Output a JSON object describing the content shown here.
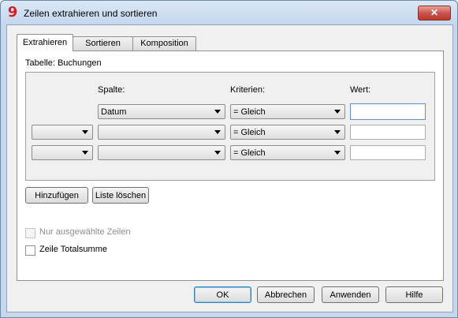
{
  "window": {
    "title": "Zeilen extrahieren und sortieren",
    "app_icon_glyph": "9",
    "close_glyph": "✕"
  },
  "tabs": [
    {
      "label": "Extrahieren",
      "active": true
    },
    {
      "label": "Sortieren",
      "active": false
    },
    {
      "label": "Komposition",
      "active": false
    }
  ],
  "table_label": "Tabelle: Buchungen",
  "columns": {
    "spalte": "Spalte:",
    "kriterien": "Kriterien:",
    "wert": "Wert:"
  },
  "rows": [
    {
      "operator": "",
      "spalte": "Datum",
      "kriterium": "= Gleich",
      "wert": ""
    },
    {
      "operator": "",
      "spalte": "",
      "kriterium": "= Gleich",
      "wert": ""
    },
    {
      "operator": "",
      "spalte": "",
      "kriterium": "= Gleich",
      "wert": ""
    }
  ],
  "buttons": {
    "add": "Hinzufügen",
    "clear_list": "Liste löschen",
    "ok": "OK",
    "cancel": "Abbrechen",
    "apply": "Anwenden",
    "help": "Hilfe"
  },
  "checkboxes": {
    "selected_rows": {
      "label": "Nur ausgewählte Zeilen",
      "checked": false,
      "enabled": false
    },
    "total_row": {
      "label": "Zeile Totalsumme",
      "checked": false,
      "enabled": true
    }
  },
  "colors": {
    "close_button": "#c75050",
    "app_icon": "#d32020",
    "focus_border": "#5e91c8"
  }
}
